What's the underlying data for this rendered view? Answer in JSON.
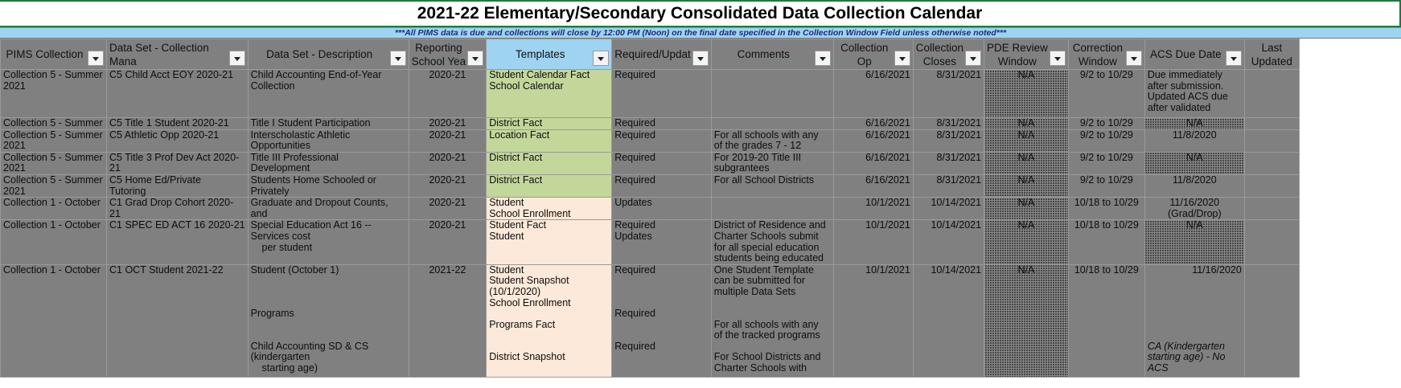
{
  "title": "2021-22 Elementary/Secondary Consolidated Data Collection Calendar",
  "notice": "***All PIMS data is due and collections will close by 12:00 PM (Noon) on the final date specified in the Collection Window Field unless otherwise noted***",
  "colors": {
    "title_border": "#1f7a3a",
    "notice_bg": "#9fd3f2",
    "cell_gray": "#808080",
    "template_green": "#c4d79b",
    "template_peach": "#fde9d9"
  },
  "headers": {
    "pims": "PIMS Collection",
    "dataset_mgr": "Data Set - Collection Mana",
    "dataset_desc": "Data Set - Description",
    "reporting_1": "Reporting",
    "reporting_2": "School Yea",
    "templates": "Templates",
    "required": "Required/Updat",
    "comments": "Comments",
    "coll_open": "Collection Op",
    "coll_close_1": "Collection",
    "coll_close_2": "Closes",
    "pde_1": "PDE Review",
    "pde_2": "Window",
    "corr_1": "Correction",
    "corr_2": "Window",
    "acs": "ACS Due Date",
    "last_1": "Last",
    "last_2": "Updated"
  },
  "rows": [
    {
      "pims": [
        "Collection 5 - Summer",
        "2021"
      ],
      "mgr": [
        "C5 Child Acct EOY 2020-21"
      ],
      "desc": [
        "Child Accounting End-of-Year",
        "Collection"
      ],
      "year": "2020-21",
      "templates": [
        "Student Calendar Fact",
        "School Calendar"
      ],
      "req": [
        "Required"
      ],
      "comments": [],
      "open": "6/16/2021",
      "close": "8/31/2021",
      "pde": "N/A",
      "corr": "9/2 to 10/29",
      "acs": [
        "Due immediately",
        "after submission.",
        "Updated ACS due",
        "after validated"
      ],
      "updated": ""
    },
    {
      "pims": [
        "Collection 5 - Summer"
      ],
      "mgr": [
        "C5 Title 1 Student 2020-21"
      ],
      "desc": [
        "Title I Student Participation"
      ],
      "year": "2020-21",
      "templates": [
        "District Fact"
      ],
      "req": [
        "Required"
      ],
      "comments": [],
      "open": "6/16/2021",
      "close": "8/31/2021",
      "pde": "N/A",
      "corr": "9/2 to 10/29",
      "acs": [
        "N/A"
      ],
      "updated": ""
    },
    {
      "pims": [
        "Collection 5 - Summer",
        "2021"
      ],
      "mgr": [
        "C5 Athletic Opp 2020-21"
      ],
      "desc": [
        "Interscholastic Athletic",
        "Opportunities"
      ],
      "year": "2020-21",
      "templates": [
        "Location Fact"
      ],
      "req": [
        "Required"
      ],
      "comments": [
        "For all schools with any",
        "of the grades 7 - 12"
      ],
      "open": "6/16/2021",
      "close": "8/31/2021",
      "pde": "N/A",
      "corr": "9/2 to 10/29",
      "acs": [
        "11/8/2020"
      ],
      "updated": ""
    },
    {
      "pims": [
        "Collection 5 - Summer",
        "2021"
      ],
      "mgr": [
        "C5 Title 3 Prof Dev Act 2020-",
        "21"
      ],
      "desc": [
        "Title III Professional",
        "Development"
      ],
      "year": "2020-21",
      "templates": [
        "District Fact"
      ],
      "req": [
        "Required"
      ],
      "comments": [
        "For 2019-20 Title III",
        "subgrantees"
      ],
      "open": "6/16/2021",
      "close": "8/31/2021",
      "pde": "N/A",
      "corr": "9/2 to 10/29",
      "acs": [
        "N/A"
      ],
      "updated": ""
    },
    {
      "pims": [
        "Collection 5 - Summer",
        "2021"
      ],
      "mgr": [
        "C5 Home Ed/Private",
        "Tutoring"
      ],
      "desc": [
        "Students Home Schooled or",
        "Privately"
      ],
      "year": "2020-21",
      "templates": [
        "District Fact"
      ],
      "req": [
        "Required"
      ],
      "comments": [
        "For all School Districts"
      ],
      "open": "6/16/2021",
      "close": "8/31/2021",
      "pde": "N/A",
      "corr": "9/2 to 10/29",
      "acs": [
        "11/8/2020"
      ],
      "updated": ""
    },
    {
      "pims": [
        "Collection 1 - October"
      ],
      "mgr": [
        "C1 Grad Drop Cohort 2020-",
        "21"
      ],
      "desc": [
        "Graduate and Dropout Counts,",
        "and"
      ],
      "year": "2020-21",
      "templates": [
        "Student",
        "School Enrollment"
      ],
      "req": [
        "Updates"
      ],
      "comments": [],
      "open": "10/1/2021",
      "close": "10/14/2021",
      "pde": "N/A",
      "corr": "10/18 to 10/29",
      "acs": [
        "11/16/2020",
        "(Grad/Drop)"
      ],
      "updated": ""
    },
    {
      "pims": [
        "Collection 1 - October"
      ],
      "mgr": [
        "C1 SPEC ED ACT 16 2020-21"
      ],
      "desc": [
        "Special Education Act 16 --",
        "Services cost",
        "    per student"
      ],
      "year": "2020-21",
      "templates": [
        "Student Fact",
        "Student"
      ],
      "req": [
        "Required",
        "Updates"
      ],
      "comments": [
        "District of Residence and",
        "Charter Schools submit",
        "for all special education",
        "students being educated"
      ],
      "open": "10/1/2021",
      "close": "10/14/2021",
      "pde": "N/A",
      "corr": "10/18 to 10/29",
      "acs": [
        "N/A"
      ],
      "updated": ""
    },
    {
      "pims": [
        "Collection 1 - October"
      ],
      "mgr": [
        "C1 OCT Student 2021-22"
      ],
      "desc": [
        "Student (October 1)",
        "",
        "",
        "",
        "Programs",
        "",
        "",
        "Child Accounting SD & CS",
        "(kindergarten",
        "    starting age)"
      ],
      "year": "2021-22",
      "templates": [
        "Student",
        "Student Snapshot",
        "(10/1/2020)",
        "School Enrollment",
        "",
        "Programs Fact",
        "",
        "",
        "District Snapshot"
      ],
      "req": [
        "Required",
        "",
        "",
        "",
        "Required",
        "",
        "",
        "Required"
      ],
      "comments": [
        "One Student Template",
        "can be submitted for",
        "multiple Data Sets",
        "",
        "",
        "For all schools with any",
        "of the tracked programs",
        "",
        "For School Districts and",
        "Charter Schools with"
      ],
      "open": "10/1/2021",
      "close": "10/14/2021",
      "pde": "N/A",
      "corr": "10/18 to 10/29",
      "acs": [
        "11/16/2020",
        "",
        "",
        "",
        "",
        "",
        "",
        "CA (Kindergarten",
        "starting age) - No",
        "ACS"
      ],
      "updated": ""
    }
  ]
}
